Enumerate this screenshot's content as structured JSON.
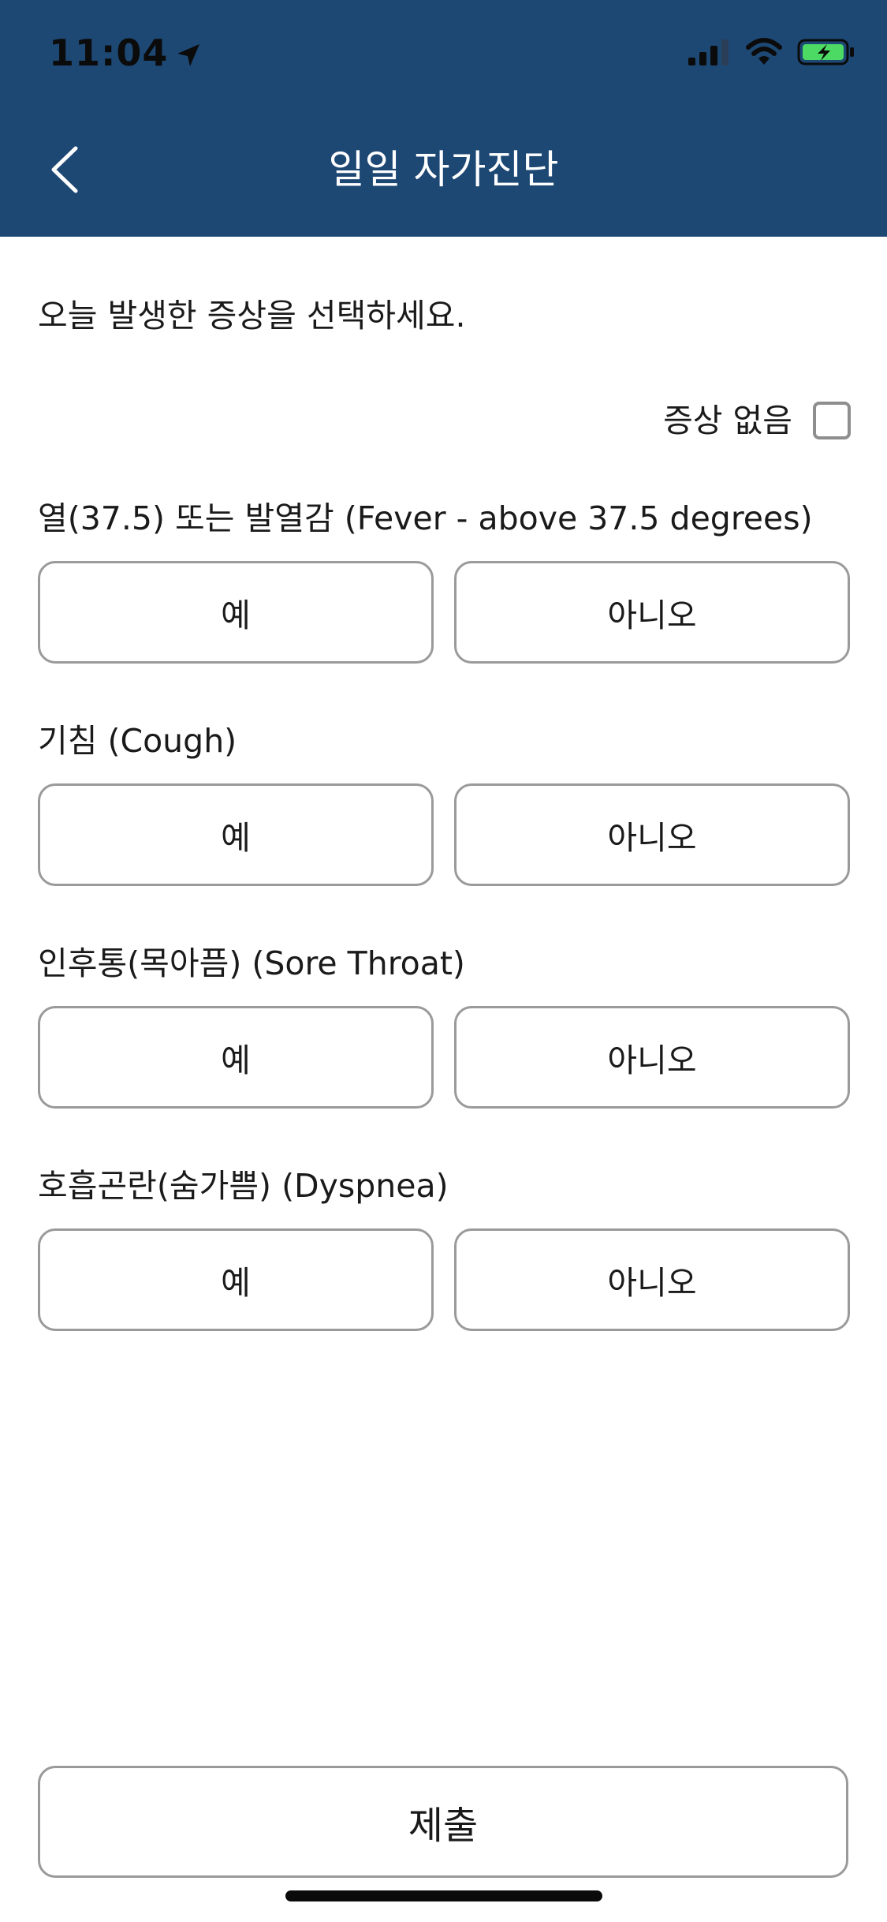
{
  "status_bar": {
    "time": "11:04",
    "icons": [
      "location-arrow-icon",
      "cellular-signal-icon",
      "wifi-icon",
      "battery-charging-icon"
    ],
    "battery_color": "#4cd964"
  },
  "header": {
    "title": "일일 자가진단",
    "background_color": "#1d4874",
    "back_icon": "chevron-left-icon"
  },
  "instruction": "오늘 발생한 증상을 선택하세요.",
  "no_symptom": {
    "label": "증상 없음",
    "checked": false
  },
  "questions": [
    {
      "label": "열(37.5) 또는 발열감 (Fever - above 37.5 degrees)",
      "yes": "예",
      "no": "아니오"
    },
    {
      "label": "기침 (Cough)",
      "yes": "예",
      "no": "아니오"
    },
    {
      "label": "인후통(목아픔) (Sore Throat)",
      "yes": "예",
      "no": "아니오"
    },
    {
      "label": "호흡곤란(숨가쁨) (Dyspnea)",
      "yes": "예",
      "no": "아니오"
    }
  ],
  "submit_label": "제출"
}
